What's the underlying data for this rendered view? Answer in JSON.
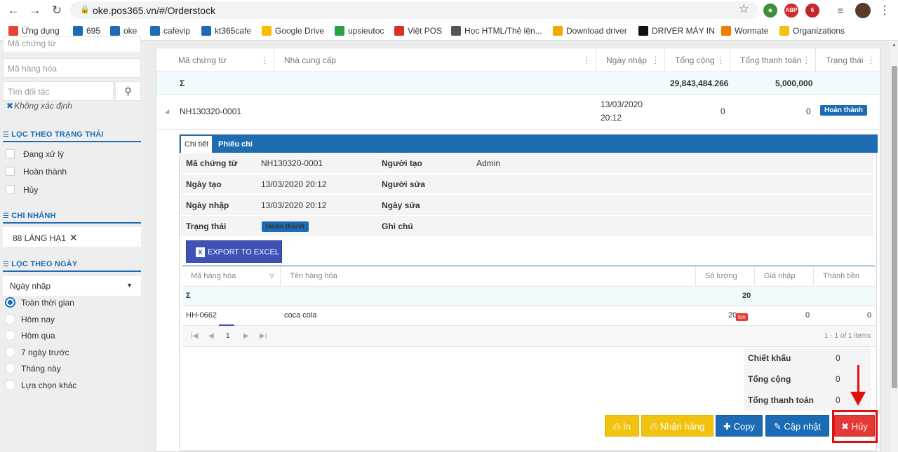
{
  "browser": {
    "url": "oke.pos365.vn/#/Orderstock",
    "bookmarks": [
      {
        "label": "Ứng dụng",
        "color": "#e94235"
      },
      {
        "label": "695",
        "color": "#1b6cb5"
      },
      {
        "label": "oke",
        "color": "#1b6cb5"
      },
      {
        "label": "cafevip",
        "color": "#1b6cb5"
      },
      {
        "label": "kt365cafe",
        "color": "#1b6cb5"
      },
      {
        "label": "Google Drive",
        "color": "#fbbc04"
      },
      {
        "label": "upsieutoc",
        "color": "#2e9e44"
      },
      {
        "label": "Việt POS",
        "color": "#d93025"
      },
      {
        "label": "Học HTML/Thẻ lện...",
        "color": "#555555"
      },
      {
        "label": "Download driver",
        "color": "#f2a900"
      },
      {
        "label": "DRIVER MÁY IN",
        "color": "#111111"
      },
      {
        "label": "Wormate",
        "color": "#f07c00"
      },
      {
        "label": "Organizations",
        "color": "#f2c30e"
      }
    ],
    "ext_abp": "ABP",
    "ext_badge": "6"
  },
  "sidebar": {
    "doc_code_placeholder": "Mã chứng từ",
    "product_code_placeholder": "Mã hàng hóa",
    "partner_placeholder": "Tìm đối tác",
    "partner_tag": "Không xác định",
    "status_title": "LỌC THEO TRẠNG THÁI",
    "status_options": [
      "Đang xử lý",
      "Hoàn thành",
      "Hủy"
    ],
    "branch_title": "CHI NHÁNH",
    "branch_value": "88 LÁNG HẠ1",
    "date_title": "LỌC THEO NGÀY",
    "date_field": "Ngày nhập",
    "date_options": [
      "Toàn thời gian",
      "Hôm nay",
      "Hôm qua",
      "7 ngày trước",
      "Tháng này",
      "Lựa chọn khác"
    ]
  },
  "grid": {
    "headers": [
      "Mã chứng từ",
      "Nhà cung cấp",
      "Ngày nhập",
      "Tổng cộng",
      "Tổng thanh toán",
      "Trạng thái"
    ],
    "sum_symbol": "Σ",
    "sum_total": "29,843,484.266",
    "sum_paid": "5,000,000",
    "row": {
      "code": "NH130320-0001",
      "date_line1": "13/03/2020",
      "date_line2": "20:12",
      "total": "0",
      "paid": "0",
      "status": "Hoàn thành"
    }
  },
  "detail": {
    "tabs": [
      "Chi tiết",
      "Phiếu chi"
    ],
    "info": {
      "doc_code_label": "Mã chứng từ",
      "doc_code": "NH130320-0001",
      "creator_label": "Người tạo",
      "creator": "Admin",
      "created_label": "Ngày tạo",
      "created": "13/03/2020 20:12",
      "editor_label": "Người sửa",
      "import_label": "Ngày nhập",
      "import_date": "13/03/2020 20:12",
      "edited_label": "Ngày sửa",
      "status_label": "Trạng thái",
      "status": "Hoàn thành",
      "note_label": "Ghi chú"
    },
    "export_label": "EXPORT TO EXCEL",
    "sub_headers": [
      "Mã hàng hóa",
      "Tên hàng hóa",
      "Số lượng",
      "Giá nhập",
      "Thành tiền"
    ],
    "sub_sum_qty": "20",
    "item": {
      "code": "HH-0662",
      "name": "coca cola",
      "qty": "20",
      "unit": "lon",
      "price": "0",
      "amount": "0"
    },
    "pager": {
      "page": "1",
      "summary": "1 - 1 of 1 items"
    },
    "totals": [
      {
        "label": "Chiết khấu",
        "value": "0"
      },
      {
        "label": "Tổng cộng",
        "value": "0"
      },
      {
        "label": "Tổng thanh toán",
        "value": "0"
      }
    ],
    "actions": {
      "print": "In",
      "receive": "Nhận hàng",
      "copy": "Copy",
      "update": "Cập nhật",
      "cancel": "Hủy"
    }
  }
}
